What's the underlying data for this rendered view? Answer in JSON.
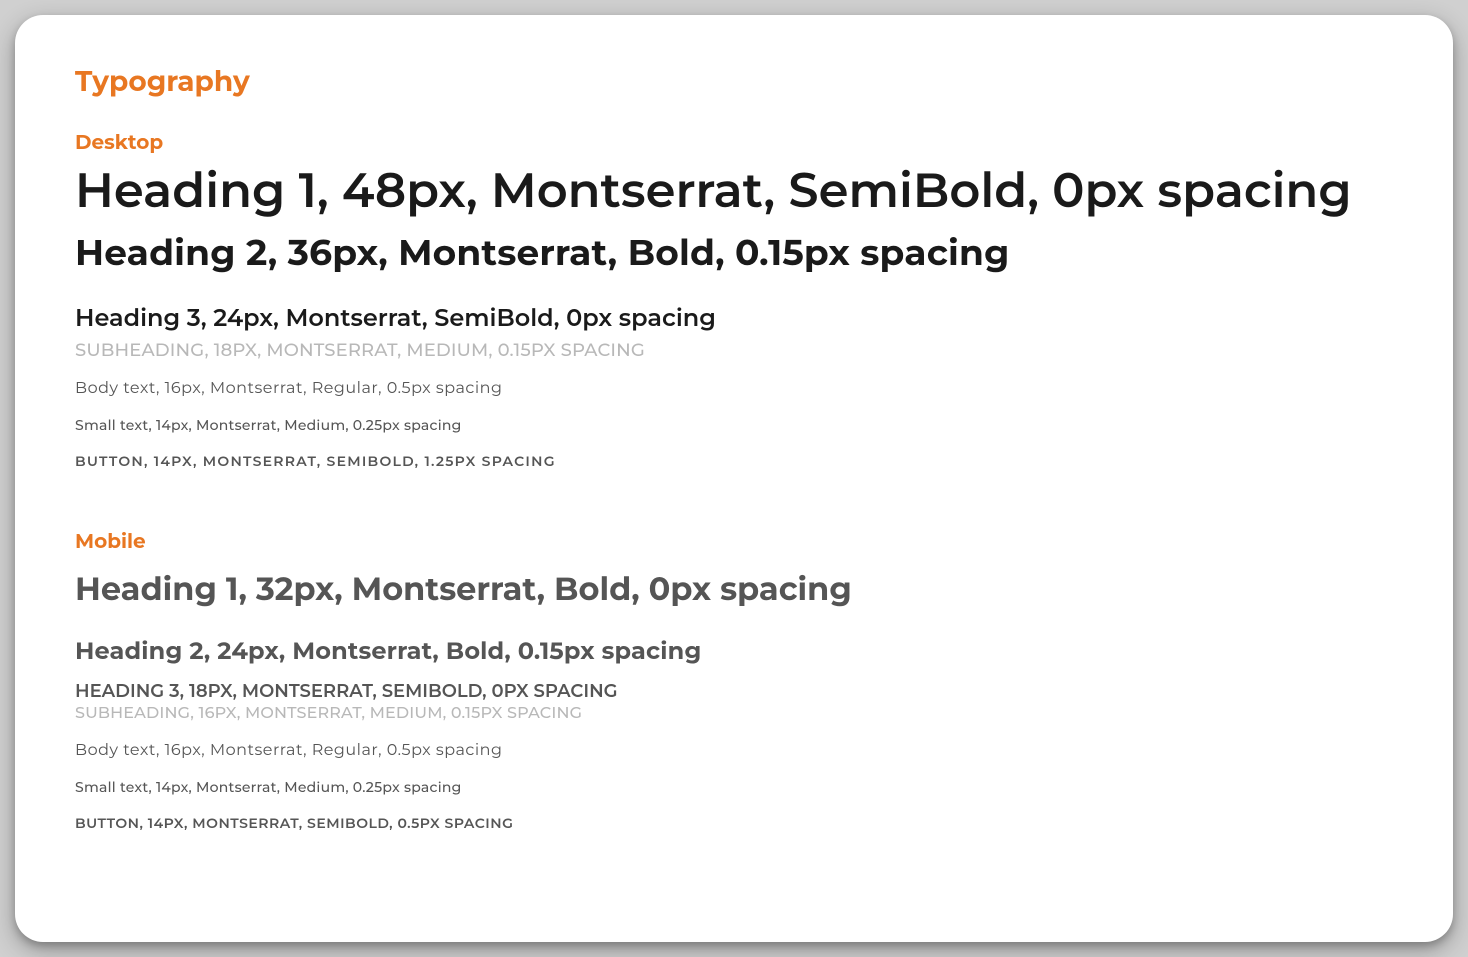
{
  "title": "Typography",
  "desktop": {
    "label": "Desktop",
    "heading1": "Heading 1, 48px, Montserrat, SemiBold, 0px spacing",
    "heading2": "Heading 2, 36px, Montserrat, Bold, 0.15px spacing",
    "heading3": "Heading 3, 24px, Montserrat, SemiBold, 0px spacing",
    "subheading": "SUBHEADING, 18PX, MONTSERRAT, MEDIUM, 0.15PX SPACING",
    "body": "Body text, 16px, Montserrat, Regular, 0.5px spacing",
    "small": "Small text, 14px, Montserrat, Medium, 0.25px spacing",
    "button": "BUTTON, 14PX, MONTSERRAT, SEMIBOLD, 1.25PX SPACING"
  },
  "mobile": {
    "label": "Mobile",
    "heading1": "Heading 1, 32px, Montserrat, Bold, 0px spacing",
    "heading2": "Heading 2, 24px, Montserrat, Bold, 0.15px spacing",
    "heading3": "HEADING 3, 18PX, MONTSERRAT, SEMIBOLD, 0PX SPACING",
    "subheading": "SUBHEADING, 16PX, MONTSERRAT, MEDIUM, 0.15PX SPACING",
    "body": "Body text, 16px, Montserrat, Regular, 0.5px spacing",
    "small": "Small text, 14px, Montserrat, Medium, 0.25px spacing",
    "button": "BUTTON, 14PX, MONTSERRAT, SEMIBOLD, 0.5PX SPACING"
  }
}
